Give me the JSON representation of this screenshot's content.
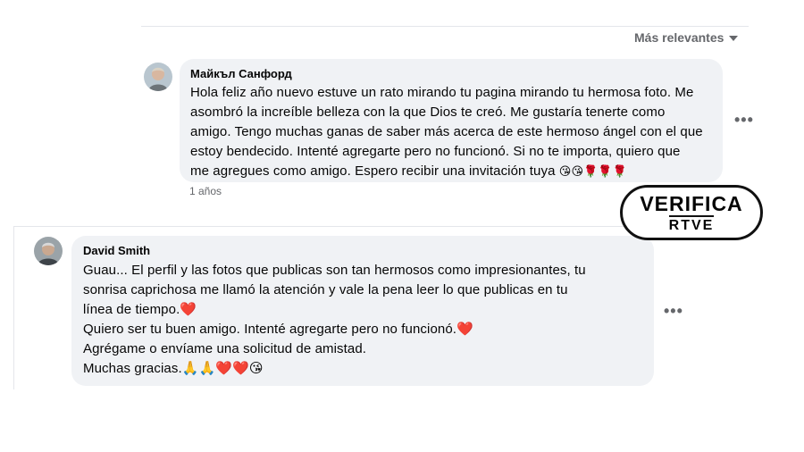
{
  "sort": {
    "label": "Más relevantes"
  },
  "comments": [
    {
      "author": "Майкъл Санфорд",
      "lines": [
        "Hola feliz año nuevo estuve un rato mirando tu pagina mirando tu hermosa foto. Me",
        "asombró la increíble belleza con la que Dios te creó. Me gustaría tenerte como",
        "amigo. Tengo muchas ganas de saber más acerca de este hermoso ángel con el que",
        "estoy bendecido. Intenté agregarte pero no funcionó. Si no te importa, quiero que",
        "me agregues como amigo. Espero recibir una invitación tuya"
      ],
      "emojis": "😘😘🌹🌹🌹",
      "time": "1 años",
      "more": "•••"
    },
    {
      "author": "David Smith",
      "lines": [
        "Guau... El perfil y las fotos que publicas son tan hermosos como impresionantes, tu",
        "sonrisa caprichosa me llamó la atención y vale la pena leer lo que publicas en tu",
        "línea de tiempo.❤️",
        "Quiero ser tu buen amigo. Intenté agregarte pero no funcionó.❤️",
        "Agrégame o envíame una solicitud de amistad.",
        "Muchas gracias.🙏🙏❤️❤️😘"
      ],
      "more": "•••"
    }
  ],
  "watermark": {
    "line1": "VERIFICA",
    "line2": "RTVE"
  }
}
